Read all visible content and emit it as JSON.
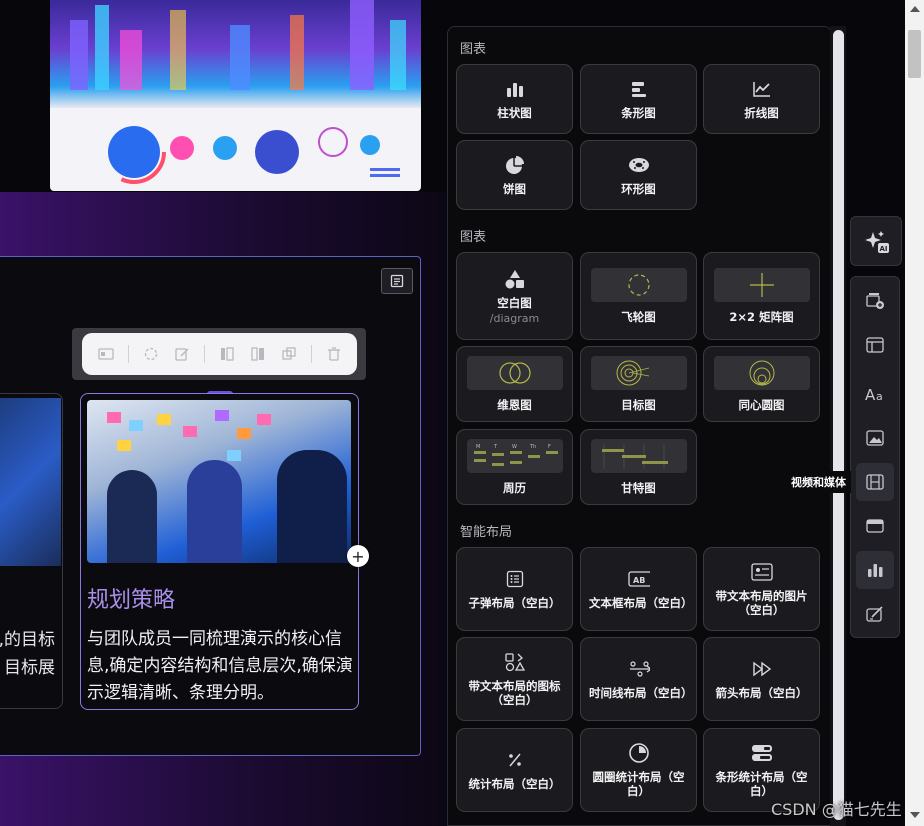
{
  "canvas": {
    "tab_card_title": "规划策略",
    "tab_card_body": "与团队成员一同梳理演示的核心信息,确定内容结构和信息层次,确保演示逻辑清晰、条理分明。",
    "left_card_fragment_1": "的目标,",
    "left_card_fragment_2": "目标展",
    "drag_handle": "•••",
    "add": "+"
  },
  "panel": {
    "section_1": "图表",
    "section_2": "图表",
    "section_3": "智能布局",
    "charts": [
      {
        "label": "柱状图",
        "icon": "bar-chart-icon"
      },
      {
        "label": "条形图",
        "icon": "horizontal-bar-chart-icon"
      },
      {
        "label": "折线图",
        "icon": "line-chart-icon"
      },
      {
        "label": "饼图",
        "icon": "pie-chart-icon"
      },
      {
        "label": "环形图",
        "icon": "donut-chart-icon"
      }
    ],
    "diagrams": [
      {
        "label": "空白图",
        "sub": "/diagram",
        "icon": "shapes-icon"
      },
      {
        "label": "飞轮图",
        "icon": "flywheel-icon"
      },
      {
        "label": "2×2 矩阵图",
        "icon": "matrix-icon"
      },
      {
        "label": "维恩图",
        "icon": "venn-icon"
      },
      {
        "label": "目标图",
        "icon": "target-icon"
      },
      {
        "label": "同心圆图",
        "icon": "concentric-icon"
      },
      {
        "label": "周历",
        "icon": "weekly-calendar-icon"
      },
      {
        "label": "甘特图",
        "icon": "gantt-icon"
      }
    ],
    "layouts": [
      {
        "label": "子弹布局（空白）",
        "icon": "bullet-list-icon"
      },
      {
        "label": "文本框布局（空白）",
        "icon": "text-box-icon"
      },
      {
        "label": "带文本布局的图片（空白）",
        "icon": "image-card-icon"
      },
      {
        "label": "带文本布局的图标（空白）",
        "icon": "icon-grid-icon"
      },
      {
        "label": "时间线布局（空白）",
        "icon": "timeline-icon"
      },
      {
        "label": "箭头布局（空白）",
        "icon": "arrows-icon"
      },
      {
        "label": "统计布局（空白）",
        "icon": "percent-icon"
      },
      {
        "label": "圆圈统计布局（空白）",
        "icon": "circle-stat-icon"
      },
      {
        "label": "条形统计布局（空白）",
        "icon": "bar-stat-icon"
      }
    ],
    "calendar_days": [
      "M",
      "T",
      "W",
      "Th",
      "F"
    ]
  },
  "rail": {
    "ai_label": "AI",
    "tooltip": "视频和媒体",
    "items": [
      "add-slide-icon",
      "template-icon",
      "text-icon",
      "image-icon",
      "video-icon",
      "embed-icon",
      "chart-icon",
      "edit-icon"
    ]
  },
  "watermark": "CSDN @猫七先生"
}
